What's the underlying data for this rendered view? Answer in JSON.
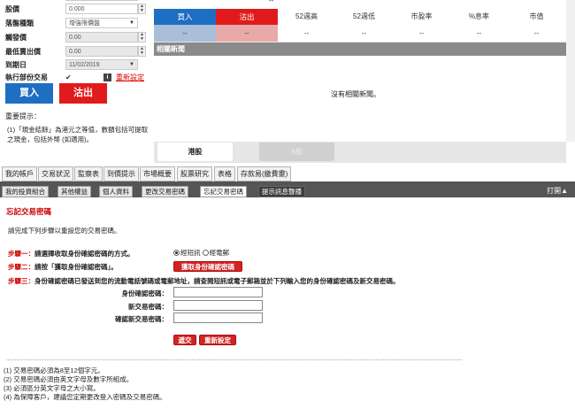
{
  "order_form": {
    "fields": [
      {
        "label": "股價",
        "value": "0.000",
        "kind": "spin"
      },
      {
        "label": "落盤種類",
        "value": "增強限價盤",
        "kind": "select"
      },
      {
        "label": "觸發價",
        "value": "0.00",
        "kind": "spin"
      },
      {
        "label": "最低賣出價",
        "value": "0.00",
        "kind": "spin"
      },
      {
        "label": "到期日",
        "value": "11/02/2019",
        "kind": "select"
      }
    ],
    "partial_trade_label": "執行部份交易",
    "partial_trade_check": "✔",
    "info_icon_glyph": "i",
    "reset_link": "重新設定",
    "buy_button": "買入",
    "sell_button": "沽出",
    "notice_title": "重要提示：",
    "notice_text": "(1)「現金結餘」為港元之等值，數額包括可提取之現金，包括外幣 (如適用)。"
  },
  "quote_panel": {
    "top_value": "--",
    "buy_label": "買入",
    "sell_label": "沽出",
    "buy_value": "--",
    "sell_value": "--",
    "columns": [
      "52週高",
      "52週低",
      "市盈率",
      "%息率",
      "市值"
    ],
    "column_values": [
      "--",
      "--",
      "--",
      "--",
      "--"
    ],
    "news_header": "相關新聞",
    "no_news": "沒有相關新聞。"
  },
  "sub_tabs": [
    "港股",
    "A股"
  ],
  "main_nav": [
    "我的帳戶",
    "交易狀況",
    "監察表",
    "到價提示",
    "市場概要",
    "股票研究",
    "表格",
    "存款易(繳費靈)"
  ],
  "secondary_nav": [
    "我的投資組合",
    "其他權益",
    "個人資料",
    "更改交易密碼",
    "忘記交易密碼",
    "提示訊息聲播"
  ],
  "print_button": "打開▲",
  "forgot_password": {
    "title": "忘記交易密碼",
    "intro": "請完成下列步驟以重設您的交易密碼。",
    "step1_label": "步驟一：",
    "step1_text": "請選擇收取身份確認密碼的方式。",
    "radio_sms": "經短訊",
    "radio_email": "經電郵",
    "step2_label": "步驟二：",
    "step2_text": "請按「獲取身份確認密碼」。",
    "get_code_button": "獲取身份確認密碼",
    "step3_label": "步驟三：",
    "step3_text": "身份確認密碼已發送到您的流動電話號碼或電郵地址，請查閱短訊或電子郵箱並於下列輸入您的身份確認密碼及新交易密碼。",
    "field_code": "身份確認密碼：",
    "field_new": "新交易密碼：",
    "field_confirm": "確認新交易密碼：",
    "submit_button": "遞交",
    "reset_button": "重新設定",
    "notes": [
      "(1) 交易密碼必須為8至12個字元。",
      "(2) 交易密碼必須由英文字母及數字所組成。",
      "(3) 必須區分英文字母之大小寫。",
      "(4) 為保障客戶，建議您定期更改登入密碼及交易密碼。"
    ]
  }
}
